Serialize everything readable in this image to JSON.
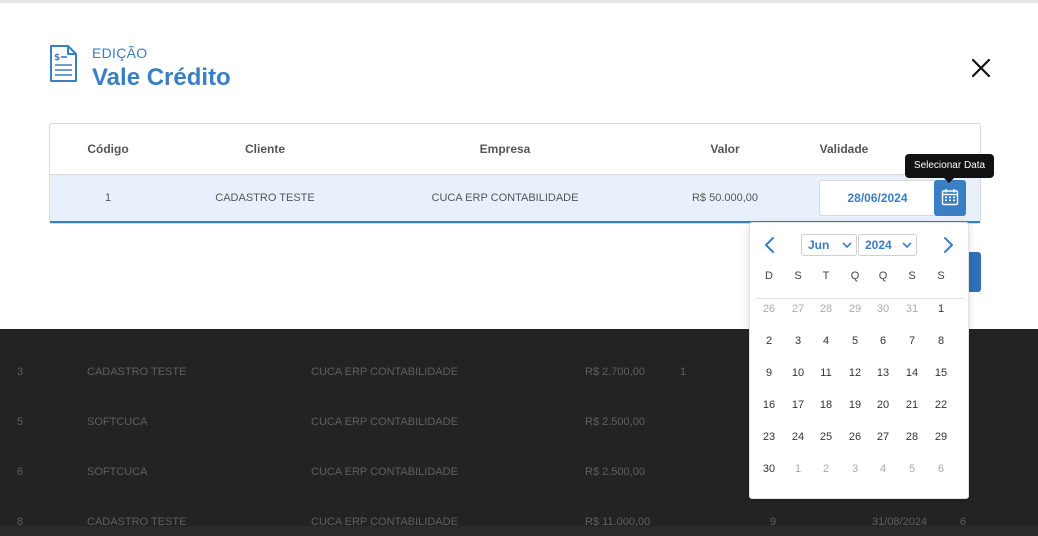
{
  "modal": {
    "subtitle": "EDIÇÃO",
    "title": "Vale Crédito",
    "icons": {
      "doc": "document-dollar-icon",
      "close": "close-icon"
    }
  },
  "table": {
    "headers": [
      "Código",
      "Cliente",
      "Empresa",
      "Valor",
      "Validade"
    ],
    "row": {
      "codigo": "1",
      "cliente": "CADASTRO TESTE",
      "empresa": "CUCA ERP CONTABILIDADE",
      "valor": "R$ 50.000,00",
      "validade": "28/06/2024"
    }
  },
  "tooltip": "Selecionar Data",
  "datepicker": {
    "month": "Jun",
    "year": "2024",
    "weekdays": [
      "D",
      "S",
      "T",
      "Q",
      "Q",
      "S",
      "S"
    ],
    "weeks": [
      [
        "26",
        "27",
        "28",
        "29",
        "30",
        "31",
        "1"
      ],
      [
        "2",
        "3",
        "4",
        "5",
        "6",
        "7",
        "8"
      ],
      [
        "9",
        "10",
        "11",
        "12",
        "13",
        "14",
        "15"
      ],
      [
        "16",
        "17",
        "18",
        "19",
        "20",
        "21",
        "22"
      ],
      [
        "23",
        "24",
        "25",
        "26",
        "27",
        "28",
        "29"
      ],
      [
        "30",
        "1",
        "2",
        "3",
        "4",
        "5",
        "6"
      ]
    ],
    "muted": [
      [
        0,
        0
      ],
      [
        0,
        1
      ],
      [
        0,
        2
      ],
      [
        0,
        3
      ],
      [
        0,
        4
      ],
      [
        0,
        5
      ],
      [
        5,
        1
      ],
      [
        5,
        2
      ],
      [
        5,
        3
      ],
      [
        5,
        4
      ],
      [
        5,
        5
      ],
      [
        5,
        6
      ]
    ]
  },
  "background_rows": [
    {
      "c1": "3",
      "c2": "CADASTRO TESTE",
      "c3": "CUCA ERP CONTABILIDADE",
      "c4": "R$ 2.700,00",
      "c5": "1",
      "c6": "",
      "c7": ""
    },
    {
      "c1": "5",
      "c2": "SOFTCUCA",
      "c3": "CUCA ERP CONTABILIDADE",
      "c4": "R$ 2.500,00",
      "c5": "",
      "c6": "",
      "c7": ""
    },
    {
      "c1": "6",
      "c2": "SOFTCUCA",
      "c3": "CUCA ERP CONTABILIDADE",
      "c4": "R$ 2.500,00",
      "c5": "",
      "c6": "",
      "c7": ""
    },
    {
      "c1": "8",
      "c2": "CADASTRO TESTE",
      "c3": "CUCA ERP CONTABILIDADE",
      "c4": "R$ 11.000,00",
      "c5": "9",
      "c6": "31/08/2024",
      "c7": "6"
    }
  ],
  "colors": {
    "accent": "#3a7ec4",
    "accent_dark": "#2f6fb8",
    "row_highlight": "#e8f1fb"
  }
}
